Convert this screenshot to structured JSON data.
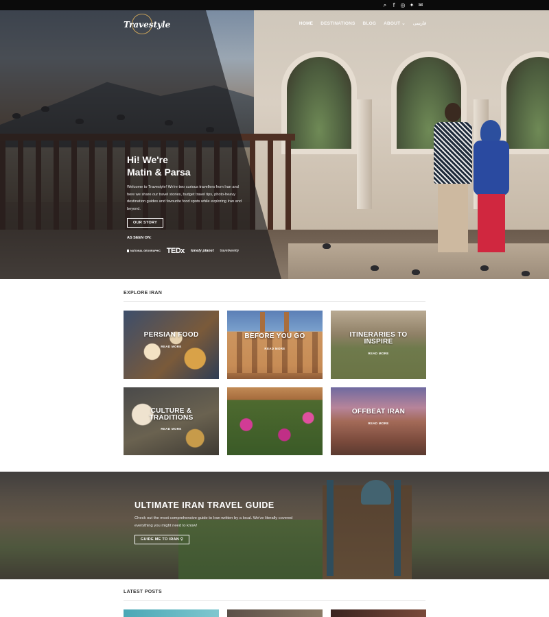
{
  "topbar": {
    "icons": [
      {
        "name": "search-icon",
        "glyph": "⌕"
      },
      {
        "name": "facebook-icon",
        "glyph": "f"
      },
      {
        "name": "instagram-icon",
        "glyph": "◎"
      },
      {
        "name": "twitter-icon",
        "glyph": "✦"
      },
      {
        "name": "email-icon",
        "glyph": "✉"
      }
    ]
  },
  "header": {
    "logo_text": "Travestyle",
    "nav": {
      "home": "HOME",
      "destinations": "DESTINATIONS",
      "blog": "BLOG",
      "about": "ABOUT",
      "about_chevron": "⌄",
      "farsi": "فارسی"
    }
  },
  "hero": {
    "title_line1": "Hi! We're",
    "title_line2": "Matin & Parsa",
    "intro": "Welcome to Travestyle! We're two curious travellers from Iran and here we share our travel stories, budget travel tips, photo-heavy destination guides and favourite food spots while exploring Iran and beyond.",
    "button": "OUR STORY",
    "as_seen_on": "AS SEEN ON:",
    "brands": {
      "national_geographic": "NATIONAL GEOGRAPHIC",
      "ted": "TEDx",
      "lonely_planet": "lonely planet",
      "travelweekly": "travelweekly"
    }
  },
  "explore": {
    "title": "EXPLORE IRAN",
    "read_more": "READ MORE",
    "tiles": [
      {
        "title": "PERSIAN FOOD"
      },
      {
        "title": "BEFORE YOU GO"
      },
      {
        "title": "ITINERARIES TO INSPIRE"
      },
      {
        "title": "CULTURE & TRADITIONS"
      },
      {
        "title": "OFFBEAT IRAN"
      }
    ]
  },
  "guide": {
    "title": "ULTIMATE IRAN TRAVEL GUIDE",
    "text": "Check out the most comprehensive guide to Iran written by a local. We've literally covered everything you might need to know!",
    "button": "GUIDE ME TO IRAN",
    "button_icon": "⚲"
  },
  "latest": {
    "title": "LATEST POSTS"
  }
}
